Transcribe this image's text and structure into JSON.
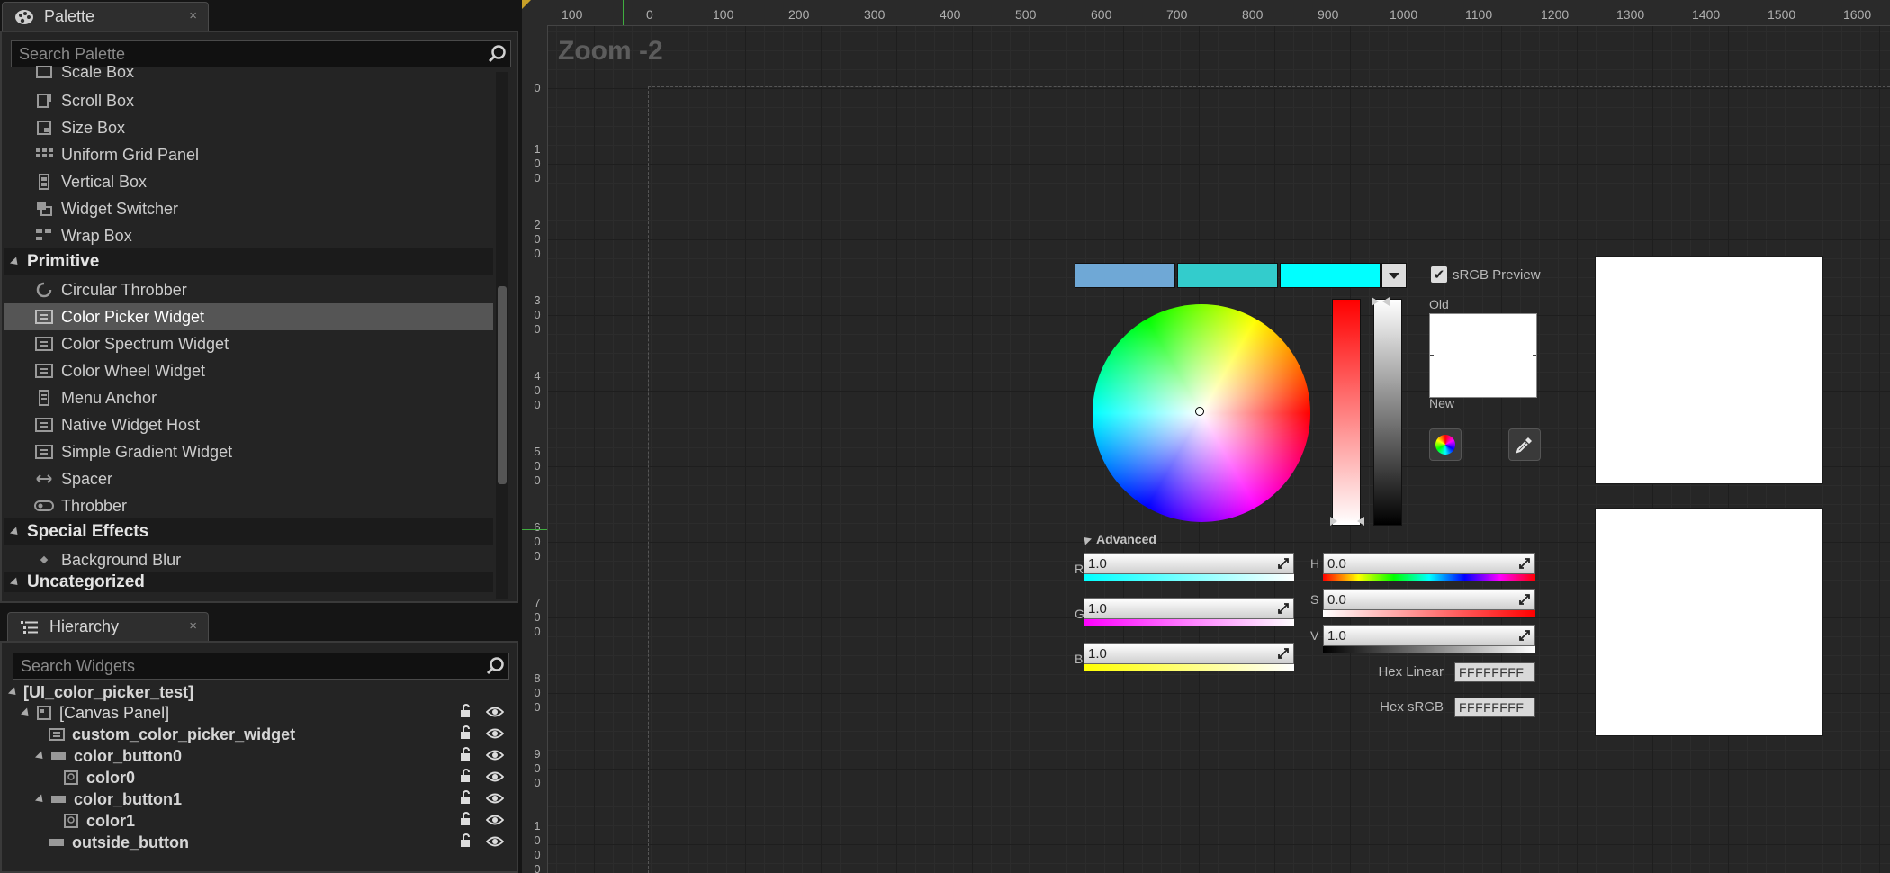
{
  "palette": {
    "tab_title": "Palette",
    "close_glyph": "×",
    "search_placeholder": "Search Palette",
    "items": [
      {
        "label": "Scale Box",
        "icon": "scale-box-icon"
      },
      {
        "label": "Scroll Box",
        "icon": "scroll-box-icon"
      },
      {
        "label": "Size Box",
        "icon": "size-box-icon"
      },
      {
        "label": "Uniform Grid Panel",
        "icon": "grid-icon"
      },
      {
        "label": "Vertical Box",
        "icon": "vertical-box-icon"
      },
      {
        "label": "Widget Switcher",
        "icon": "switcher-icon"
      },
      {
        "label": "Wrap Box",
        "icon": "wrap-box-icon"
      }
    ],
    "category_primitive": "Primitive",
    "primitive_items": [
      {
        "label": "Circular Throbber",
        "icon": "throbber-circle-icon"
      },
      {
        "label": "Color Picker Widget",
        "icon": "widget-icon",
        "selected": true
      },
      {
        "label": "Color Spectrum Widget",
        "icon": "widget-icon"
      },
      {
        "label": "Color Wheel Widget",
        "icon": "widget-icon"
      },
      {
        "label": "Menu Anchor",
        "icon": "menu-anchor-icon"
      },
      {
        "label": "Native Widget Host",
        "icon": "widget-icon"
      },
      {
        "label": "Simple Gradient Widget",
        "icon": "widget-icon"
      },
      {
        "label": "Spacer",
        "icon": "spacer-icon"
      },
      {
        "label": "Throbber",
        "icon": "throbber-icon"
      }
    ],
    "category_special": "Special Effects",
    "special_items": [
      {
        "label": "Background Blur",
        "icon": "diamond-icon"
      }
    ],
    "category_uncategorized": "Uncategorized"
  },
  "hierarchy": {
    "tab_title": "Hierarchy",
    "close_glyph": "×",
    "search_placeholder": "Search Widgets",
    "rows": [
      {
        "label": "[UI_color_picker_test]",
        "depth": 0
      },
      {
        "label": "[Canvas Panel]",
        "depth": 1
      },
      {
        "label": "custom_color_picker_widget",
        "depth": 2
      },
      {
        "label": "color_button0",
        "depth": 2
      },
      {
        "label": "color0",
        "depth": 3
      },
      {
        "label": "color_button1",
        "depth": 2
      },
      {
        "label": "color1",
        "depth": 3
      },
      {
        "label": "outside_button",
        "depth": 2
      }
    ]
  },
  "designer": {
    "zoom_label": "Zoom -2",
    "ruler_top": [
      "100",
      "0",
      "100",
      "200",
      "300",
      "400",
      "500",
      "600",
      "700",
      "800",
      "900",
      "1000",
      "1100",
      "1200",
      "1300",
      "1400",
      "1500",
      "1600"
    ],
    "ruler_left": [
      "0",
      "100",
      "200",
      "300",
      "400",
      "500",
      "600",
      "700",
      "800",
      "900",
      "1000"
    ]
  },
  "color_picker": {
    "swatch_colors": [
      "#6fa8d6",
      "#33cccc",
      "#00ffff"
    ],
    "srgb_preview_label": "sRGB Preview",
    "srgb_preview_checked": true,
    "old_label": "Old",
    "new_label": "New",
    "advanced_label": "Advanced",
    "channels": {
      "r": {
        "letter": "R",
        "value": "1.0"
      },
      "g": {
        "letter": "G",
        "value": "1.0"
      },
      "b": {
        "letter": "B",
        "value": "1.0"
      },
      "h": {
        "letter": "H",
        "value": "0.0"
      },
      "s": {
        "letter": "S",
        "value": "0.0"
      },
      "v": {
        "letter": "V",
        "value": "1.0"
      }
    },
    "hex_linear_label": "Hex Linear",
    "hex_linear_value": "FFFFFFFF",
    "hex_srgb_label": "Hex sRGB",
    "hex_srgb_value": "FFFFFFFF"
  }
}
